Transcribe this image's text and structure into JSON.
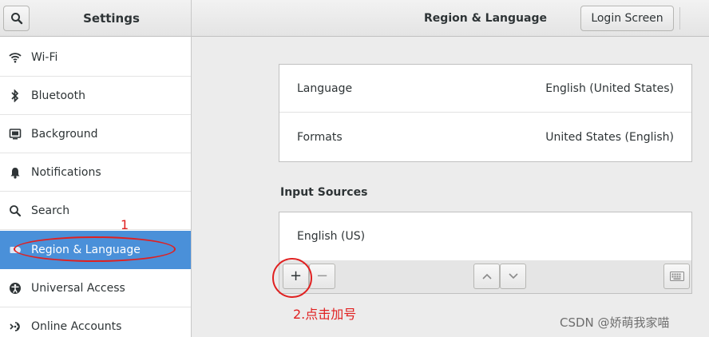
{
  "sidebar_header": {
    "title": "Settings",
    "search_icon": "search-icon"
  },
  "header": {
    "title": "Region & Language",
    "login_button": "Login Screen"
  },
  "sidebar": {
    "items": [
      {
        "label": "Wi-Fi",
        "icon": "wifi-icon"
      },
      {
        "label": "Bluetooth",
        "icon": "bluetooth-icon"
      },
      {
        "label": "Background",
        "icon": "background-icon"
      },
      {
        "label": "Notifications",
        "icon": "bell-icon"
      },
      {
        "label": "Search",
        "icon": "search-icon"
      },
      {
        "label": "Region & Language",
        "icon": "region-icon",
        "active": true
      },
      {
        "label": "Universal Access",
        "icon": "accessibility-icon"
      },
      {
        "label": "Online Accounts",
        "icon": "online-accounts-icon"
      }
    ]
  },
  "language_panel": {
    "rows": [
      {
        "label": "Language",
        "value": "English (United States)"
      },
      {
        "label": "Formats",
        "value": "United States (English)"
      }
    ]
  },
  "input_sources": {
    "title": "Input Sources",
    "items": [
      "English (US)"
    ],
    "toolbar": {
      "add": "+",
      "remove": "−"
    }
  },
  "annotations": {
    "step1": "1",
    "step2": "2.点击加号"
  },
  "watermark": "CSDN @娇萌我家喵",
  "colors": {
    "selection": "#4a90d9",
    "annotation": "#e02020"
  }
}
